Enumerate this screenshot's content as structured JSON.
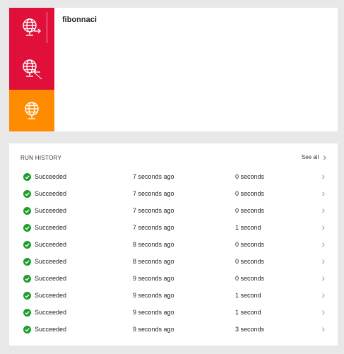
{
  "workflow": {
    "name": "fibonnaci"
  },
  "colors": {
    "tile_primary": "#e0103a",
    "tile_secondary": "#ff8c00",
    "success": "#1e9e2c"
  },
  "icons": {
    "trigger": "globe-arrow-out-icon",
    "action": "globe-arrow-in-icon",
    "response": "globe-icon"
  },
  "run_history": {
    "title": "RUN HISTORY",
    "see_all_label": "See all",
    "rows": [
      {
        "status": "Succeeded",
        "started": "7 seconds ago",
        "duration": "0 seconds"
      },
      {
        "status": "Succeeded",
        "started": "7 seconds ago",
        "duration": "0 seconds"
      },
      {
        "status": "Succeeded",
        "started": "7 seconds ago",
        "duration": "0 seconds"
      },
      {
        "status": "Succeeded",
        "started": "7 seconds ago",
        "duration": "1 second"
      },
      {
        "status": "Succeeded",
        "started": "8 seconds ago",
        "duration": "0 seconds"
      },
      {
        "status": "Succeeded",
        "started": "8 seconds ago",
        "duration": "0 seconds"
      },
      {
        "status": "Succeeded",
        "started": "9 seconds ago",
        "duration": "0 seconds"
      },
      {
        "status": "Succeeded",
        "started": "9 seconds ago",
        "duration": "1 second"
      },
      {
        "status": "Succeeded",
        "started": "9 seconds ago",
        "duration": "1 second"
      },
      {
        "status": "Succeeded",
        "started": "9 seconds ago",
        "duration": "3 seconds"
      }
    ]
  }
}
